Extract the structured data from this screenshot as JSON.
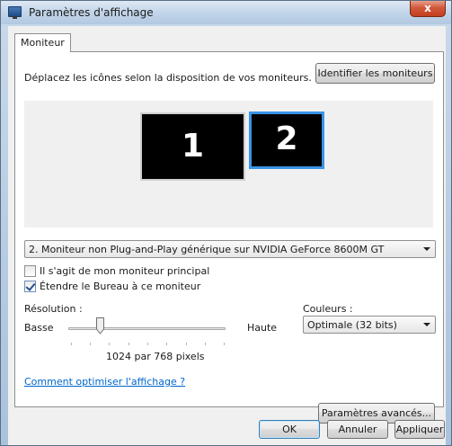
{
  "window": {
    "title": "Paramètres d'affichage",
    "close_glyph": "x"
  },
  "tabs": [
    {
      "label": "Moniteur"
    }
  ],
  "monitors": {
    "instruction": "Déplacez les icônes selon la disposition de vos moniteurs.",
    "identify_button": "Identifier les moniteurs",
    "monitor_1": "1",
    "monitor_2": "2",
    "selected_monitor": "2",
    "selected_accent": "#3a94e8"
  },
  "monitor_select": {
    "value": "2. Moniteur non Plug-and-Play générique sur NVIDIA GeForce 8600M GT"
  },
  "options": {
    "primary_label": "Il s'agit de mon moniteur principal",
    "primary_checked": false,
    "extend_label": "Étendre le Bureau à ce moniteur",
    "extend_checked": true
  },
  "resolution": {
    "label": "Résolution :",
    "low_label": "Basse",
    "high_label": "Haute",
    "value_text": "1024 par 768 pixels",
    "slider_position_fraction": 0.2
  },
  "colors": {
    "label": "Couleurs :",
    "value": "Optimale (32 bits)"
  },
  "help_link": "Comment optimiser l'affichage ?",
  "advanced_button": "Paramètres avancés...",
  "footer": {
    "ok": "OK",
    "cancel": "Annuler",
    "apply": "Appliquer"
  }
}
